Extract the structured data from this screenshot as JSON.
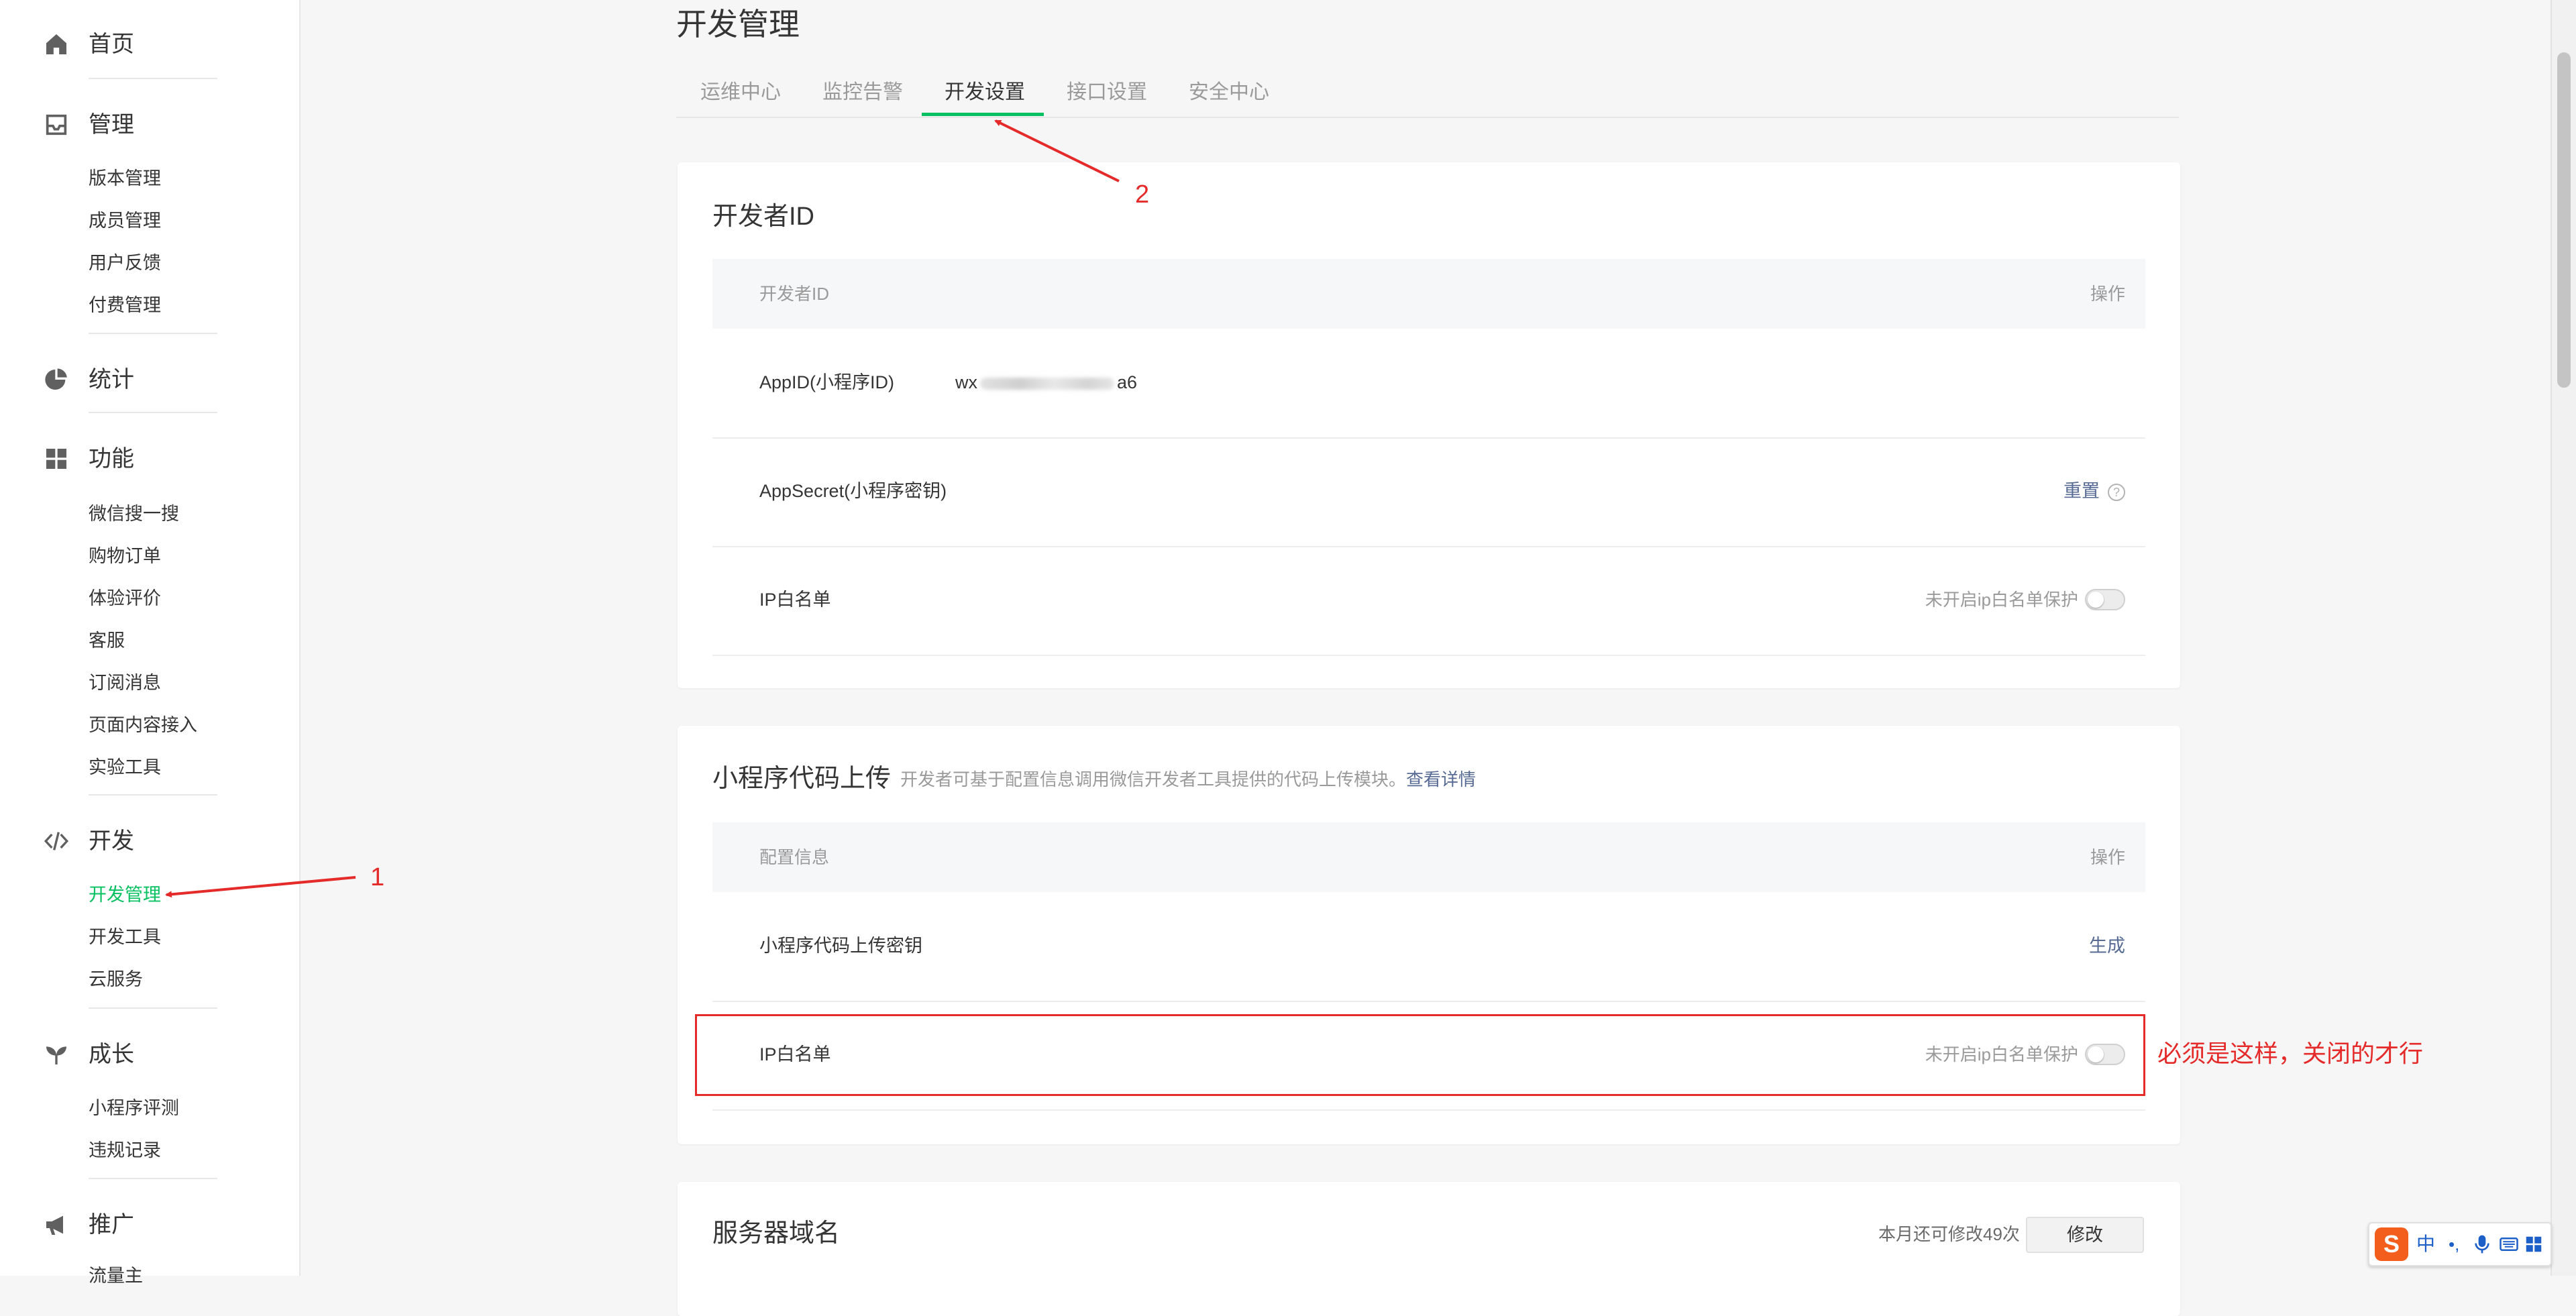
{
  "sidebar": {
    "groups": [
      {
        "label": "首页",
        "icon": "home-icon"
      },
      {
        "label": "管理",
        "icon": "inbox-icon",
        "items": [
          "版本管理",
          "成员管理",
          "用户反馈",
          "付费管理"
        ]
      },
      {
        "label": "统计",
        "icon": "pie-chart-icon"
      },
      {
        "label": "功能",
        "icon": "grid-icon",
        "items": [
          "微信搜一搜",
          "购物订单",
          "体验评价",
          "客服",
          "订阅消息",
          "页面内容接入",
          "实验工具"
        ]
      },
      {
        "label": "开发",
        "icon": "code-icon",
        "items": [
          "开发管理",
          "开发工具",
          "云服务"
        ]
      },
      {
        "label": "成长",
        "icon": "sprout-icon",
        "items": [
          "小程序评测",
          "违规记录"
        ]
      },
      {
        "label": "推广",
        "icon": "megaphone-icon",
        "items": [
          "流量主"
        ]
      }
    ],
    "active_item": "开发管理"
  },
  "page_title": "开发管理",
  "tabs": [
    "运维中心",
    "监控告警",
    "开发设置",
    "接口设置",
    "安全中心"
  ],
  "active_tab": "开发设置",
  "developer_id": {
    "title": "开发者ID",
    "col_left": "开发者ID",
    "col_right": "操作",
    "rows": {
      "appid_label": "AppID(小程序ID)",
      "appid_prefix": "wx",
      "appid_suffix": "a6",
      "secret_label": "AppSecret(小程序密钥)",
      "secret_action": "重置",
      "ip_label": "IP白名单",
      "ip_status": "未开启ip白名单保护"
    }
  },
  "code_upload": {
    "title": "小程序代码上传",
    "desc": "开发者可基于配置信息调用微信开发者工具提供的代码上传模块。",
    "desc_link": "查看详情",
    "col_left": "配置信息",
    "col_right": "操作",
    "rows": {
      "key_label": "小程序代码上传密钥",
      "key_action": "生成",
      "ip_label": "IP白名单",
      "ip_status": "未开启ip白名单保护"
    }
  },
  "server_domain": {
    "title": "服务器域名",
    "quota": "本月还可修改49次",
    "modify": "修改"
  },
  "annotations": {
    "num1": "1",
    "num2": "2",
    "note": "必须是这样，关闭的才行",
    "color": "#e52a2a"
  },
  "ime": {
    "lang": "中"
  },
  "colors": {
    "accent": "#07c160",
    "link": "#576b95",
    "annotation": "#e52a2a"
  }
}
